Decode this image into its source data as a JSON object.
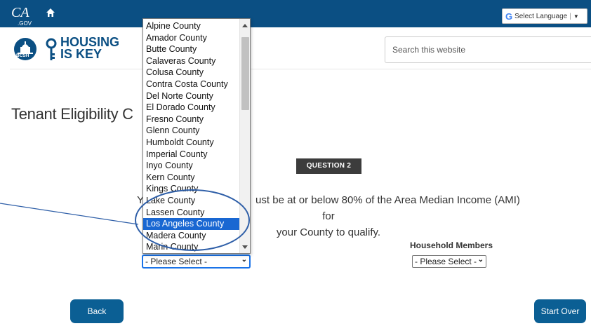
{
  "header": {
    "ca_logo": "CA",
    "ca_logo_sub": ".GOV",
    "language_label": "Select Language",
    "language_arrow": "▼"
  },
  "brand": {
    "seal_text": "BCSH",
    "line1": "HOUSING",
    "line2": "IS KEY"
  },
  "search": {
    "placeholder": "Search this website"
  },
  "page": {
    "title": "Tenant Eligibility C"
  },
  "question": {
    "badge": "QUESTION 2",
    "text_start": "Yo",
    "text_mid": "ust be at or below 80% of the Area Median Income (AMI) for",
    "text_line2": "your County to qualify."
  },
  "county_select": {
    "value": "- Please Select -",
    "options": [
      "Alpine County",
      "Amador County",
      "Butte County",
      "Calaveras County",
      "Colusa County",
      "Contra Costa County",
      "Del Norte County",
      "El Dorado County",
      "Fresno County",
      "Glenn County",
      "Humboldt County",
      "Imperial County",
      "Inyo County",
      "Kern County",
      "Kings County",
      "Lake County",
      "Lassen County",
      "Los Angeles County",
      "Madera County",
      "Marin County"
    ],
    "selected_option": "Los Angeles County"
  },
  "household": {
    "label": "Household Members",
    "value": "- Please Select -"
  },
  "buttons": {
    "back": "Back",
    "start_over": "Start Over"
  },
  "colors": {
    "header_bg": "#0b4f83",
    "button_bg": "#0b5f94",
    "badge_bg": "#3c3c3c",
    "highlight": "#1967d2",
    "annotation": "#2f5fa8"
  }
}
